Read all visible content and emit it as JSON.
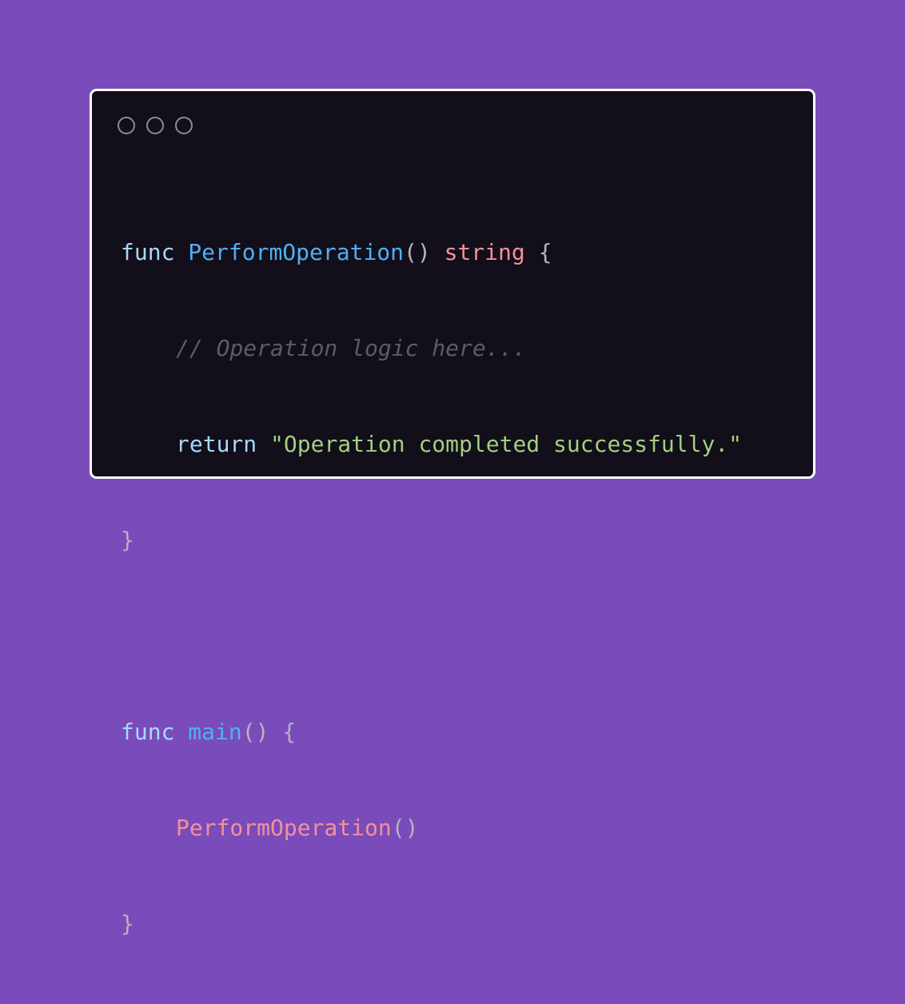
{
  "window": {
    "controls": [
      "close",
      "minimize",
      "maximize"
    ]
  },
  "code": {
    "line1": {
      "keyword": "func",
      "name": "PerformOperation",
      "parens": "()",
      "type": "string",
      "brace": "{"
    },
    "line2": {
      "comment": "// Operation logic here..."
    },
    "line3": {
      "keyword": "return",
      "string": "\"Operation completed successfully.\""
    },
    "line4": {
      "brace": "}"
    },
    "line6": {
      "keyword": "func",
      "name": "main",
      "parens": "()",
      "brace": "{"
    },
    "line7": {
      "call": "PerformOperation",
      "parens": "()"
    },
    "line8": {
      "brace": "}"
    }
  },
  "colors": {
    "background": "#7a4bba",
    "editor": "#120e1a",
    "keyword": "#a6d9ff",
    "function": "#4fb0f5",
    "type": "#f4919b",
    "comment": "#5e5b69",
    "string": "#a2cf7f"
  }
}
